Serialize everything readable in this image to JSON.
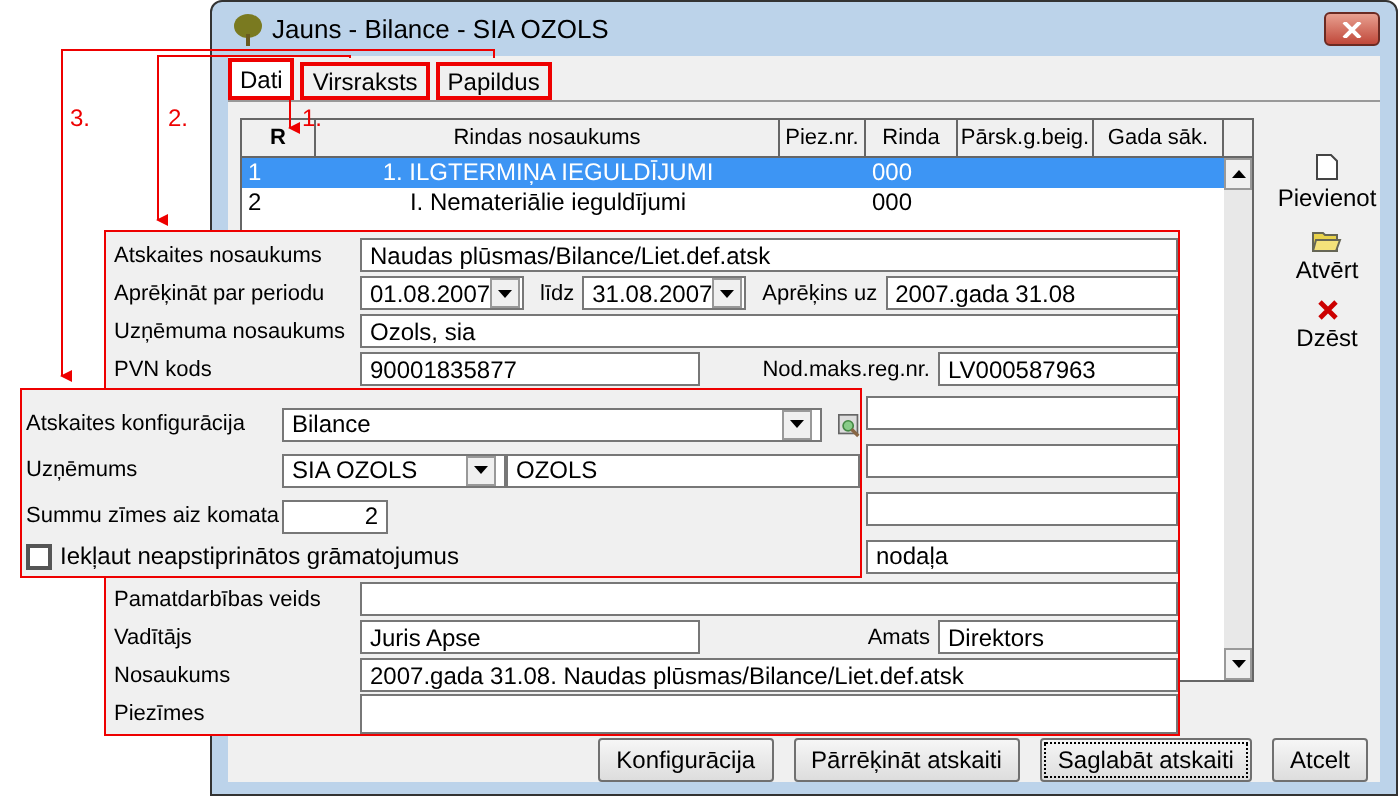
{
  "window": {
    "title": "Jauns - Bilance - SIA OZOLS"
  },
  "tabs": [
    {
      "label": "Dati",
      "selected": true
    },
    {
      "label": "Virsraksts",
      "selected": false
    },
    {
      "label": "Papildus",
      "selected": false
    }
  ],
  "table": {
    "columns": [
      "R",
      "Rindas nosaukums",
      "Piez.nr.",
      "Rinda",
      "Pārsk.g.beig.",
      "Gada sāk."
    ],
    "rows": [
      {
        "cells": [
          "1",
          "1. ILGTERMIŅA IEGULDĪJUMI",
          "",
          "000",
          "",
          ""
        ],
        "selected": true
      },
      {
        "cells": [
          "2",
          "I. Nemateriālie ieguldījumi",
          "",
          "000",
          "",
          ""
        ],
        "selected": false
      }
    ]
  },
  "side_buttons": [
    {
      "kind": "new",
      "label": "Pievienot"
    },
    {
      "kind": "open",
      "label": "Atvērt"
    },
    {
      "kind": "delete",
      "label": "Dzēst"
    }
  ],
  "footer_buttons": [
    {
      "label": "Konfigurācija",
      "focused": false
    },
    {
      "label": "Pārrēķināt atskaiti",
      "focused": false
    },
    {
      "label": "Saglabāt atskaiti",
      "focused": true
    },
    {
      "label": "Atcelt",
      "focused": false
    }
  ],
  "callouts": [
    "3.",
    "2.",
    "1."
  ],
  "report_panel": {
    "rows": [
      {
        "kind": "text",
        "label": "Atskaites nosaukums",
        "value": "Naudas plūsmas/Bilance/Liet.def.atsk"
      },
      {
        "kind": "period",
        "label": "Aprēķināt par periodu",
        "from": "01.08.2007",
        "to_label": "līdz",
        "to": "31.08.2007",
        "calc_label": "Aprēķins uz",
        "calc_value": "2007.gada 31.08"
      },
      {
        "kind": "text",
        "label": "Uzņēmuma nosaukums",
        "value": "Ozols, sia"
      },
      {
        "kind": "pair",
        "label": "PVN kods",
        "value": "90001835877",
        "label2": "Nod.maks.reg.nr.",
        "value2": "LV000587963"
      },
      {
        "kind": "partial"
      },
      {
        "kind": "partial"
      },
      {
        "kind": "partial"
      },
      {
        "kind": "partial",
        "value": "nodaļa"
      },
      {
        "kind": "text",
        "label": "Pamatdarbības veids"
      },
      {
        "kind": "pair",
        "label": "Vadītājs",
        "value": "Juris Apse",
        "label2": "Amats",
        "value2": "Direktors"
      },
      {
        "kind": "text",
        "label": "Nosaukums",
        "value": "2007.gada 31.08. Naudas plūsmas/Bilance/Liet.def.atsk"
      },
      {
        "kind": "memo",
        "label": "Piezīmes"
      }
    ]
  },
  "settings_panel": {
    "config": {
      "label": "Atskaites konfigurācija",
      "value": "Bilance"
    },
    "company": {
      "label": "Uzņēmums",
      "code": "SIA OZOLS",
      "name": "OZOLS"
    },
    "decimals": {
      "label": "Summu zīmes aiz komata",
      "value": "2"
    },
    "include_unconfirmed": {
      "label": "Iekļaut neapstiprinātos grāmatojumus",
      "checked": false
    }
  }
}
